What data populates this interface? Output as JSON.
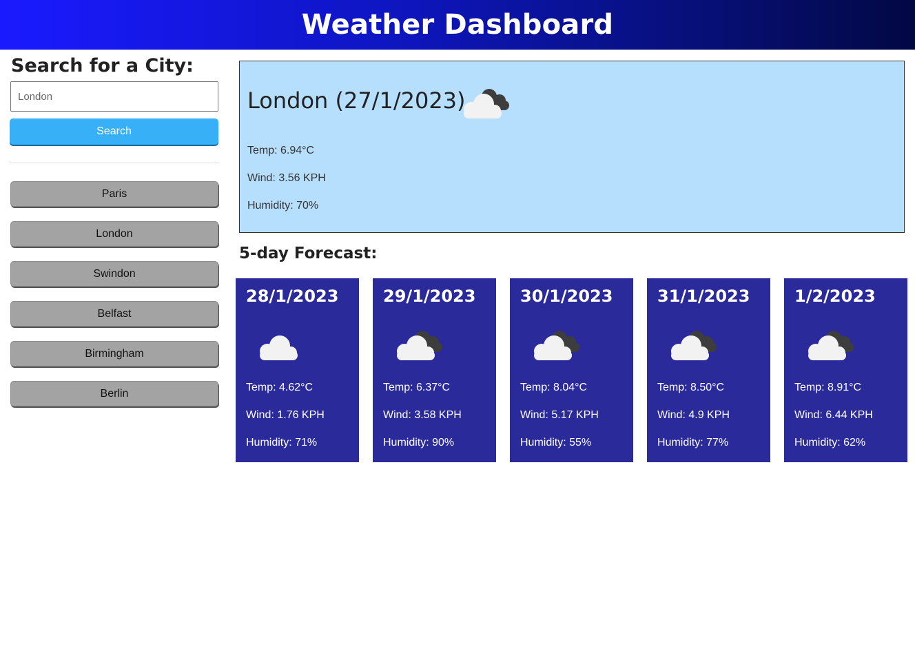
{
  "header": {
    "title": "Weather Dashboard"
  },
  "search": {
    "heading": "Search for a City:",
    "placeholder": "London",
    "button_label": "Search"
  },
  "history": [
    {
      "label": "Paris"
    },
    {
      "label": "London"
    },
    {
      "label": "Swindon"
    },
    {
      "label": "Belfast"
    },
    {
      "label": "Birmingham"
    },
    {
      "label": "Berlin"
    }
  ],
  "current": {
    "title": "London (27/1/2023)",
    "icon": "cloudy-icon",
    "temp": "Temp: 6.94°C",
    "wind": "Wind: 3.56 KPH",
    "humidity": "Humidity: 70%"
  },
  "forecast": {
    "heading": "5-day Forecast:",
    "days": [
      {
        "date": "28/1/2023",
        "icon": "cloud-icon",
        "temp": "Temp: 4.62°C",
        "wind": "Wind: 1.76 KPH",
        "humidity": "Humidity: 71%"
      },
      {
        "date": "29/1/2023",
        "icon": "cloudy-icon",
        "temp": "Temp: 6.37°C",
        "wind": "Wind: 3.58 KPH",
        "humidity": "Humidity: 90%"
      },
      {
        "date": "30/1/2023",
        "icon": "cloudy-icon",
        "temp": "Temp: 8.04°C",
        "wind": "Wind: 5.17 KPH",
        "humidity": "Humidity: 55%"
      },
      {
        "date": "31/1/2023",
        "icon": "cloudy-icon",
        "temp": "Temp: 8.50°C",
        "wind": "Wind: 4.9 KPH",
        "humidity": "Humidity: 77%"
      },
      {
        "date": "1/2/2023",
        "icon": "cloudy-icon",
        "temp": "Temp: 8.91°C",
        "wind": "Wind: 6.44 KPH",
        "humidity": "Humidity: 62%"
      }
    ]
  },
  "colors": {
    "header_start": "#1a1aff",
    "header_end": "#020844",
    "search_button": "#37b0f8",
    "history_button": "#a3a3a3",
    "current_bg": "#b6dffe",
    "card_bg": "#2b2a9b"
  }
}
